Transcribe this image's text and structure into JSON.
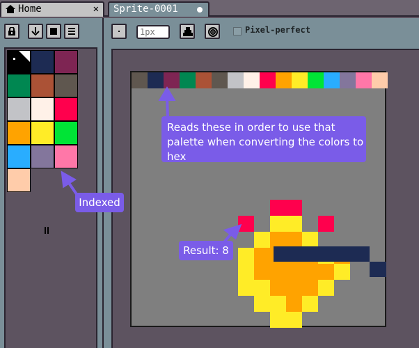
{
  "tabs": [
    {
      "label": "Home",
      "icon": "home-icon",
      "close": "✕"
    },
    {
      "label": "Sprite-0001",
      "icon": "unsaved-dot-icon"
    }
  ],
  "toolbar": {
    "left_icons": [
      "lock-icon",
      "arrow-down-icon",
      "square-icon",
      "menu-icon"
    ],
    "pixel_icon": "pixel-dot-icon",
    "brush_size": {
      "value": "",
      "placeholder": "1px"
    },
    "ink_icon": "ink-bottle-icon",
    "symmetry_icon": "target-icon",
    "pixel_perfect": {
      "label": "Pixel-perfect",
      "checked": false
    }
  },
  "palette": {
    "colors": [
      "#000000",
      "#ffffff",
      "#1d2b53",
      "#7e2553",
      "#008751",
      "#ab5236",
      "#5f574f",
      "#c2c3c7",
      "#fff1e8",
      "#ff004d",
      "#ffa300",
      "#ffec27",
      "#00e436",
      "#29adff",
      "#83769c",
      "#ff77a8",
      "#ffccaa"
    ],
    "first_cell": "fg-bg-indicator"
  },
  "canvas": {
    "background": "#7f7f7f",
    "palette_strip": [
      "#1d2b53",
      "#7e2553",
      "#008751",
      "#ab5236",
      "#5f574f",
      "#c2c3c7",
      "#fff1e8",
      "#ff004d",
      "#ffa300",
      "#ffec27",
      "#00e436",
      "#29adff",
      "#83769c",
      "#ff77a8",
      "#ffccaa"
    ],
    "strip_gap_color": "#5f574f"
  },
  "annotations": {
    "palette_note": "Reads these in order to use that palette when converting the colors to hex",
    "indexed_note": "Indexed",
    "result_note": "Result: 8",
    "accent": "#7a5ce8"
  }
}
